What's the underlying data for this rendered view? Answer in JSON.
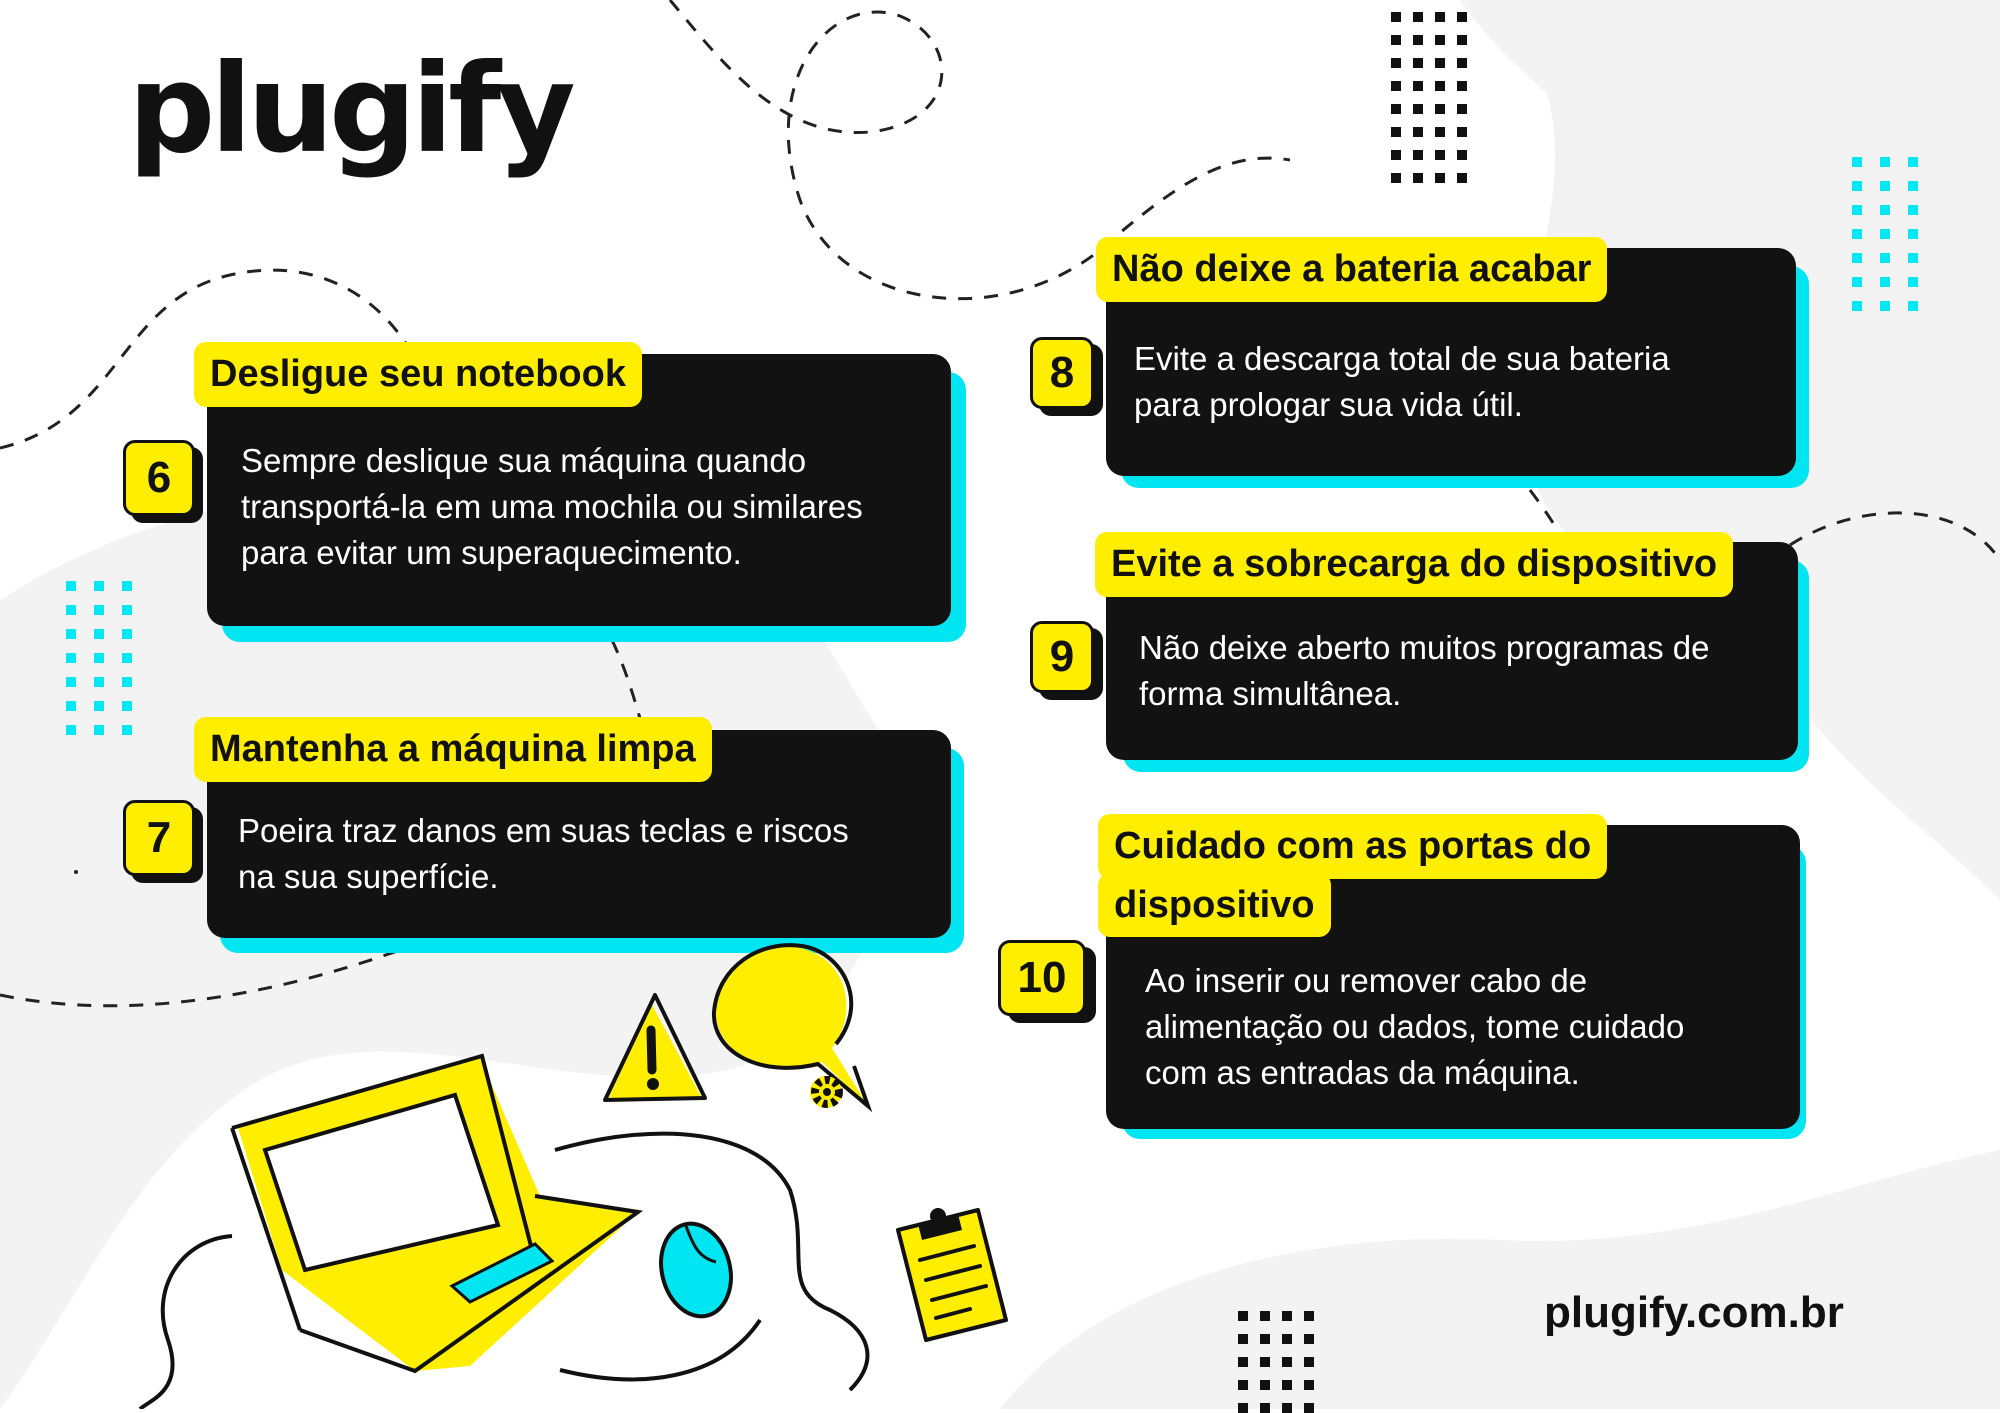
{
  "brand": {
    "name": "plugify",
    "website": "plugify.com.br"
  },
  "colors": {
    "accent_yellow": "#ffee00",
    "accent_cyan": "#00e5f2",
    "card_bg": "#121212",
    "text_dark": "#111111"
  },
  "tips": [
    {
      "number": "6",
      "title": "Desligue seu notebook",
      "body_lines": [
        "Sempre deslique sua máquina quando",
        "transportá-la em uma mochila ou similares",
        "para evitar um superaquecimento."
      ]
    },
    {
      "number": "7",
      "title": "Mantenha a máquina limpa",
      "body_lines": [
        "Poeira traz danos em suas teclas e riscos",
        "na sua superfície."
      ]
    },
    {
      "number": "8",
      "title": "Não deixe a bateria acabar",
      "body_lines": [
        "Evite a descarga total de sua bateria",
        "para prologar sua vida útil."
      ]
    },
    {
      "number": "9",
      "title": "Evite a sobrecarga do dispositivo",
      "body_lines": [
        "Não deixe aberto muitos programas de",
        "forma simultânea."
      ]
    },
    {
      "number": "10",
      "title_lines": [
        "Cuidado com as portas do",
        "dispositivo"
      ],
      "body_lines": [
        "Ao inserir ou remover cabo de",
        "alimentação ou dados, tome cuidado",
        "com as entradas da máquina."
      ]
    }
  ],
  "illustration": {
    "icons": [
      "laptop-icon",
      "warning-icon",
      "gear-bubble-icon",
      "mouse-icon",
      "clipboard-icon"
    ]
  }
}
